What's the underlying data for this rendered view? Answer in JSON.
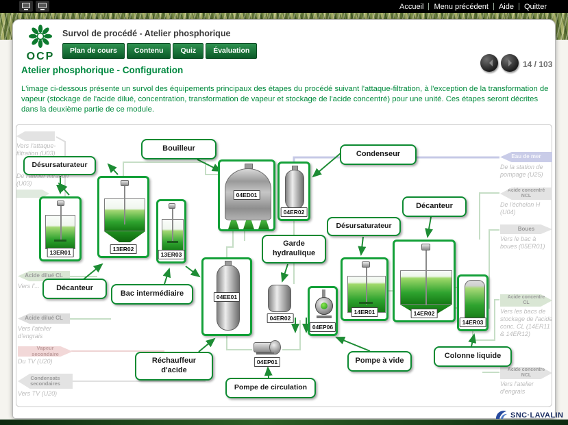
{
  "topbar": {
    "menu": [
      "Accueil",
      "Menu précédent",
      "Aide",
      "Quitter"
    ]
  },
  "header": {
    "logo": "OCP",
    "title": "Survol de procédé - Atelier phosphorique",
    "tabs": [
      "Plan de cours",
      "Contenu",
      "Quiz",
      "Évaluation"
    ]
  },
  "page": {
    "heading": "Atelier phosphorique  - Configuration",
    "pager": "14 / 103",
    "intro": "L'image ci-dessous présente un survol des équipements principaux des étapes du procédé suivant l'attaque-filtration, à l'exception de la transformation de vapeur (stockage de l'acide dilué, concentration, transformation de vapeur et stockage de l'acide concentré) pour une unité. Ces étapes seront décrites dans la deuxième partie de ce module."
  },
  "diagram": {
    "callouts": {
      "bouilleur": "Bouilleur",
      "condenseur": "Condenseur",
      "desursaturateur_left": "Désursaturateur",
      "desursaturateur_right": "Désursaturateur",
      "decanteur_left": "Décanteur",
      "decanteur_right": "Décanteur",
      "garde_hydraulique": "Garde hydraulique",
      "bac_intermediaire": "Bac intermédiaire",
      "rechauffeur_acide": "Réchauffeur d'acide",
      "pompe_circulation": "Pompe de circulation",
      "pompe_a_vide": "Pompe à vide",
      "colonne_liquide": "Colonne liquide"
    },
    "tags": {
      "er13_01": "13ER01",
      "er13_02": "13ER02",
      "er13_03": "13ER03",
      "ed04_01": "04ED01",
      "er04_02_top": "04ER02",
      "ee04_01": "04EE01",
      "er04_02_small": "04ER02",
      "ep04_06": "04EP06",
      "ep04_01": "04EP01",
      "er14_01": "14ER01",
      "er14_02": "14ER02",
      "er14_03": "14ER03"
    },
    "streams_left": [
      {
        "title": "",
        "sub": "Vers l'attaque-filtration (U03)"
      },
      {
        "title": "",
        "sub": "De l'atelier filtration (U03)"
      },
      {
        "title": "Acide dilué CL",
        "sub": "Vers l'..."
      },
      {
        "title": "Acide dilué CL",
        "sub": "Vers l'atelier d'engrais"
      },
      {
        "title": "Vapeur secondaire",
        "sub": "Du TV (U20)"
      },
      {
        "title": "Condensats secondaires",
        "sub": "Vers TV (U20)"
      }
    ],
    "streams_right": [
      {
        "title": "Eau de mer",
        "sub": "De la station de pompage (U25)"
      },
      {
        "title": "Acide concentré NCL",
        "sub": "De l'échelon H (U04)"
      },
      {
        "title": "Boues",
        "sub": "Vers le bac à boues (05ER01)"
      },
      {
        "title": "Acide concentré CL",
        "sub": "Vers les bacs de stockage de l'acide conc. CL (14ER11 & 14ER12)"
      },
      {
        "title": "Acide concentré NCL",
        "sub": "Vers l'atelier d'engrais"
      }
    ]
  },
  "footer": {
    "brand": "SNC·LAVALIN"
  },
  "colors": {
    "accent_green": "#00883f",
    "equipment_box_green": "#13a038",
    "tab_green": "#0b5a28",
    "brand_navy": "#1c2f63"
  }
}
